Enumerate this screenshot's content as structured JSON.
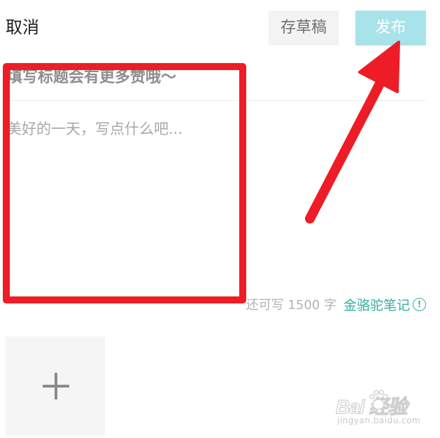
{
  "header": {
    "cancel_label": "取消",
    "draft_label": "存草稿",
    "publish_label": "发布"
  },
  "editor": {
    "title_placeholder": "填写标题会有更多赞哦～",
    "body_placeholder": "美好的一天，写点什么吧...",
    "char_remaining": "还可写 1500 字",
    "camel_link": "金骆驼笔记",
    "info_glyph": "!"
  },
  "media": {
    "add_icon": "plus-icon"
  },
  "annotation": {
    "color": "#ee1c26"
  },
  "watermark": {
    "brand": "Bai  经验",
    "site": "jingyan.baidu.com"
  },
  "colors": {
    "publish_bg": "#a9e3ea",
    "link": "#36b0a0",
    "draft_bg": "#f3f3f3"
  }
}
